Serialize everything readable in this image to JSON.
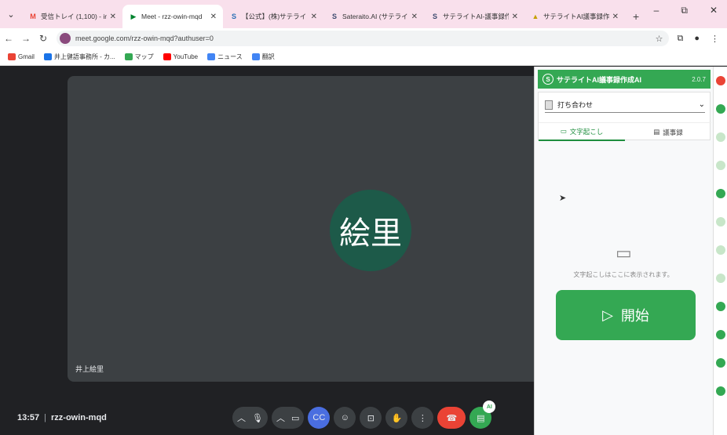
{
  "browser": {
    "tab_menu_glyph": "⌄",
    "tabs": [
      {
        "title": "受信トレイ (1,100) - inou",
        "favicon": "gmail-icon",
        "favicon_glyph": "M",
        "color": "#ea4335",
        "active": false
      },
      {
        "title": "Meet - rzz-owin-mqd",
        "favicon": "meet-icon",
        "favicon_glyph": "▶",
        "color": "#00832d",
        "active": true
      },
      {
        "title": "【公式】(株)サテライトオフィ",
        "favicon": "sateraito-icon",
        "favicon_glyph": "S",
        "color": "#2a6fb5",
        "active": false
      },
      {
        "title": "Sateraito.AI (サテライト",
        "favicon": "sateraito-icon",
        "favicon_glyph": "S",
        "color": "#3c4a6e",
        "active": false
      },
      {
        "title": "サテライトAI-議事録作成",
        "favicon": "sateraito-icon",
        "favicon_glyph": "S",
        "color": "#3c4a6e",
        "active": false
      },
      {
        "title": "サテライトAI議事録作成",
        "favicon": "drive-icon",
        "favicon_glyph": "▲",
        "color": "#c5a000",
        "active": false
      }
    ],
    "newtab_glyph": "+",
    "window_controls": [
      "–",
      "⧉",
      "✕"
    ],
    "url": "meet.google.com/rzz-owin-mqd?authuser=0",
    "bookmarks": [
      {
        "label": "Gmail",
        "color": "#ea4335"
      },
      {
        "label": "井上健語事務所 - カ...",
        "color": "#1a73e8"
      },
      {
        "label": "マップ",
        "color": "#34a853"
      },
      {
        "label": "YouTube",
        "color": "#ff0000"
      },
      {
        "label": "ニュース",
        "color": "#4285f4"
      },
      {
        "label": "翻訳",
        "color": "#4285f4"
      }
    ]
  },
  "meet": {
    "avatar_text": "絵里",
    "participant_name": "井上絵里",
    "time": "13:57",
    "meeting_code": "rzz-owin-mqd",
    "avatar_color": "#1d5a49"
  },
  "panel": {
    "title": "サテライトAI議事録作成AI",
    "version": "2.0.7",
    "selected_template": "打ち合わせ",
    "tab_transcription": "文字起こし",
    "tab_minutes": "議事録",
    "empty_message": "文字起こしはここに表示されます。",
    "start_label": "開始",
    "accent_color": "#34a853"
  }
}
